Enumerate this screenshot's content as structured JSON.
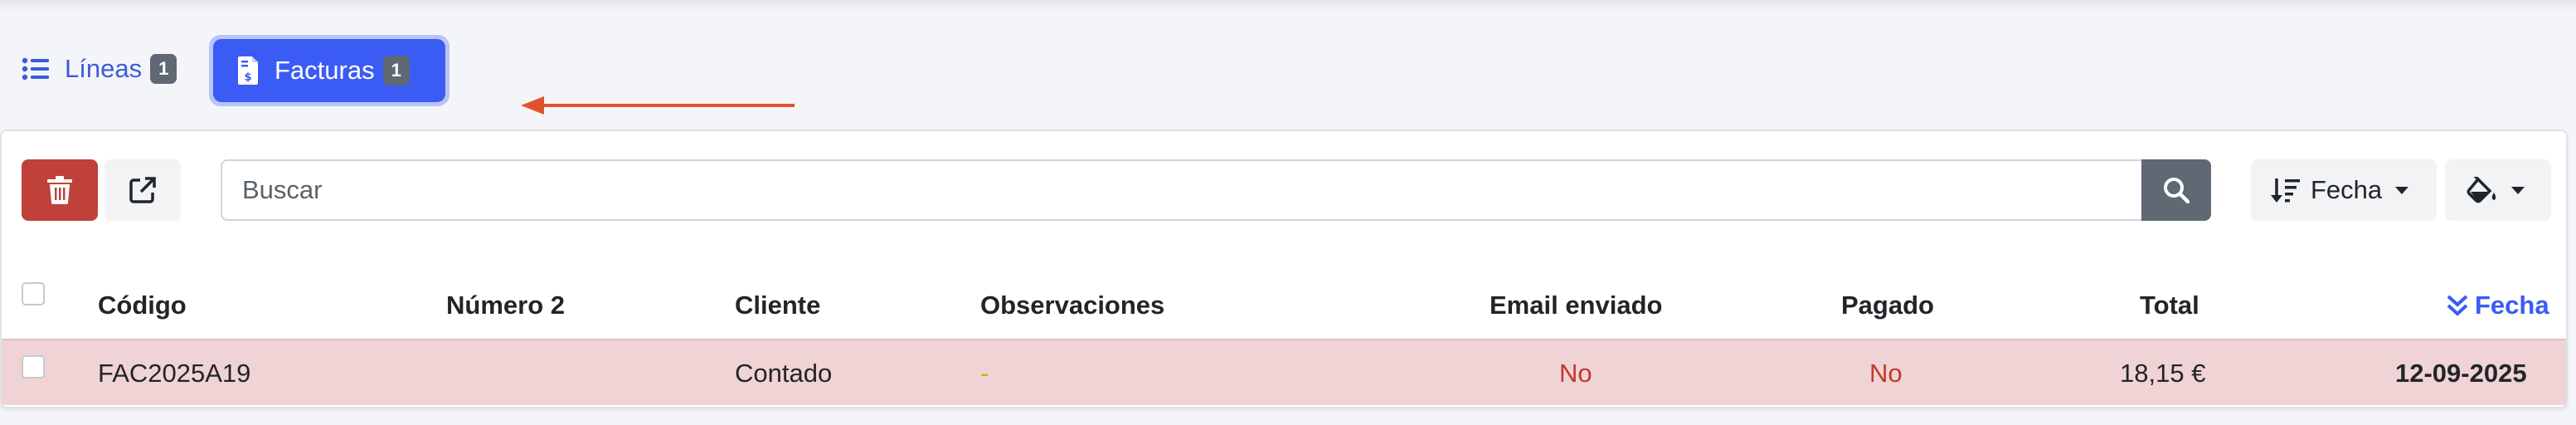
{
  "tabs": [
    {
      "label": "Líneas",
      "count": "1"
    },
    {
      "label": "Facturas",
      "count": "1"
    }
  ],
  "toolbar": {
    "search_placeholder": "Buscar",
    "sort_label": "Fecha"
  },
  "table": {
    "headers": {
      "codigo": "Código",
      "numero2": "Número 2",
      "cliente": "Cliente",
      "observaciones": "Observaciones",
      "email": "Email enviado",
      "pagado": "Pagado",
      "total": "Total",
      "fecha": "Fecha"
    },
    "rows": [
      {
        "codigo": "FAC2025A19",
        "numero2": "",
        "cliente": "Contado",
        "observaciones": "-",
        "email": "No",
        "pagado": "No",
        "total": "18,15 €",
        "fecha": "12-09-2025"
      }
    ]
  },
  "colors": {
    "primary": "#3b5bf5",
    "danger": "#c0413a",
    "row_highlight": "#f0d3d5",
    "annotation_arrow": "#e0532f"
  },
  "icons": [
    "list-icon",
    "invoice-icon",
    "trash-icon",
    "external-link-icon",
    "search-icon",
    "sort-icon",
    "paint-bucket-icon",
    "chevron-double-down-icon"
  ]
}
